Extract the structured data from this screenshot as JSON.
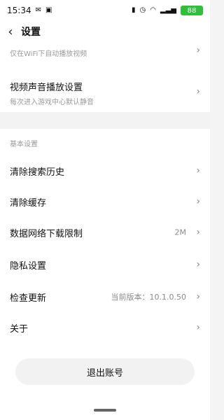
{
  "status_bar": {
    "time": "15:34",
    "battery": "88"
  },
  "header": {
    "title": "设置"
  },
  "top_section": {
    "clipped_item_sub": "仅在WiFi下自动播放视频",
    "video_sound": {
      "label": "视频声音播放设置",
      "sub": "每次进入游戏中心默认静音"
    }
  },
  "basic_settings": {
    "section_title": "基本设置",
    "items": [
      {
        "label": "清除搜索历史",
        "value": ""
      },
      {
        "label": "清除缓存",
        "value": ""
      },
      {
        "label": "数据网络下载限制",
        "value": "2M"
      },
      {
        "label": "隐私设置",
        "value": ""
      },
      {
        "label": "检查更新",
        "value": "当前版本：10.1.0.50"
      },
      {
        "label": "关于",
        "value": ""
      }
    ]
  },
  "logout": {
    "label": "退出账号"
  }
}
